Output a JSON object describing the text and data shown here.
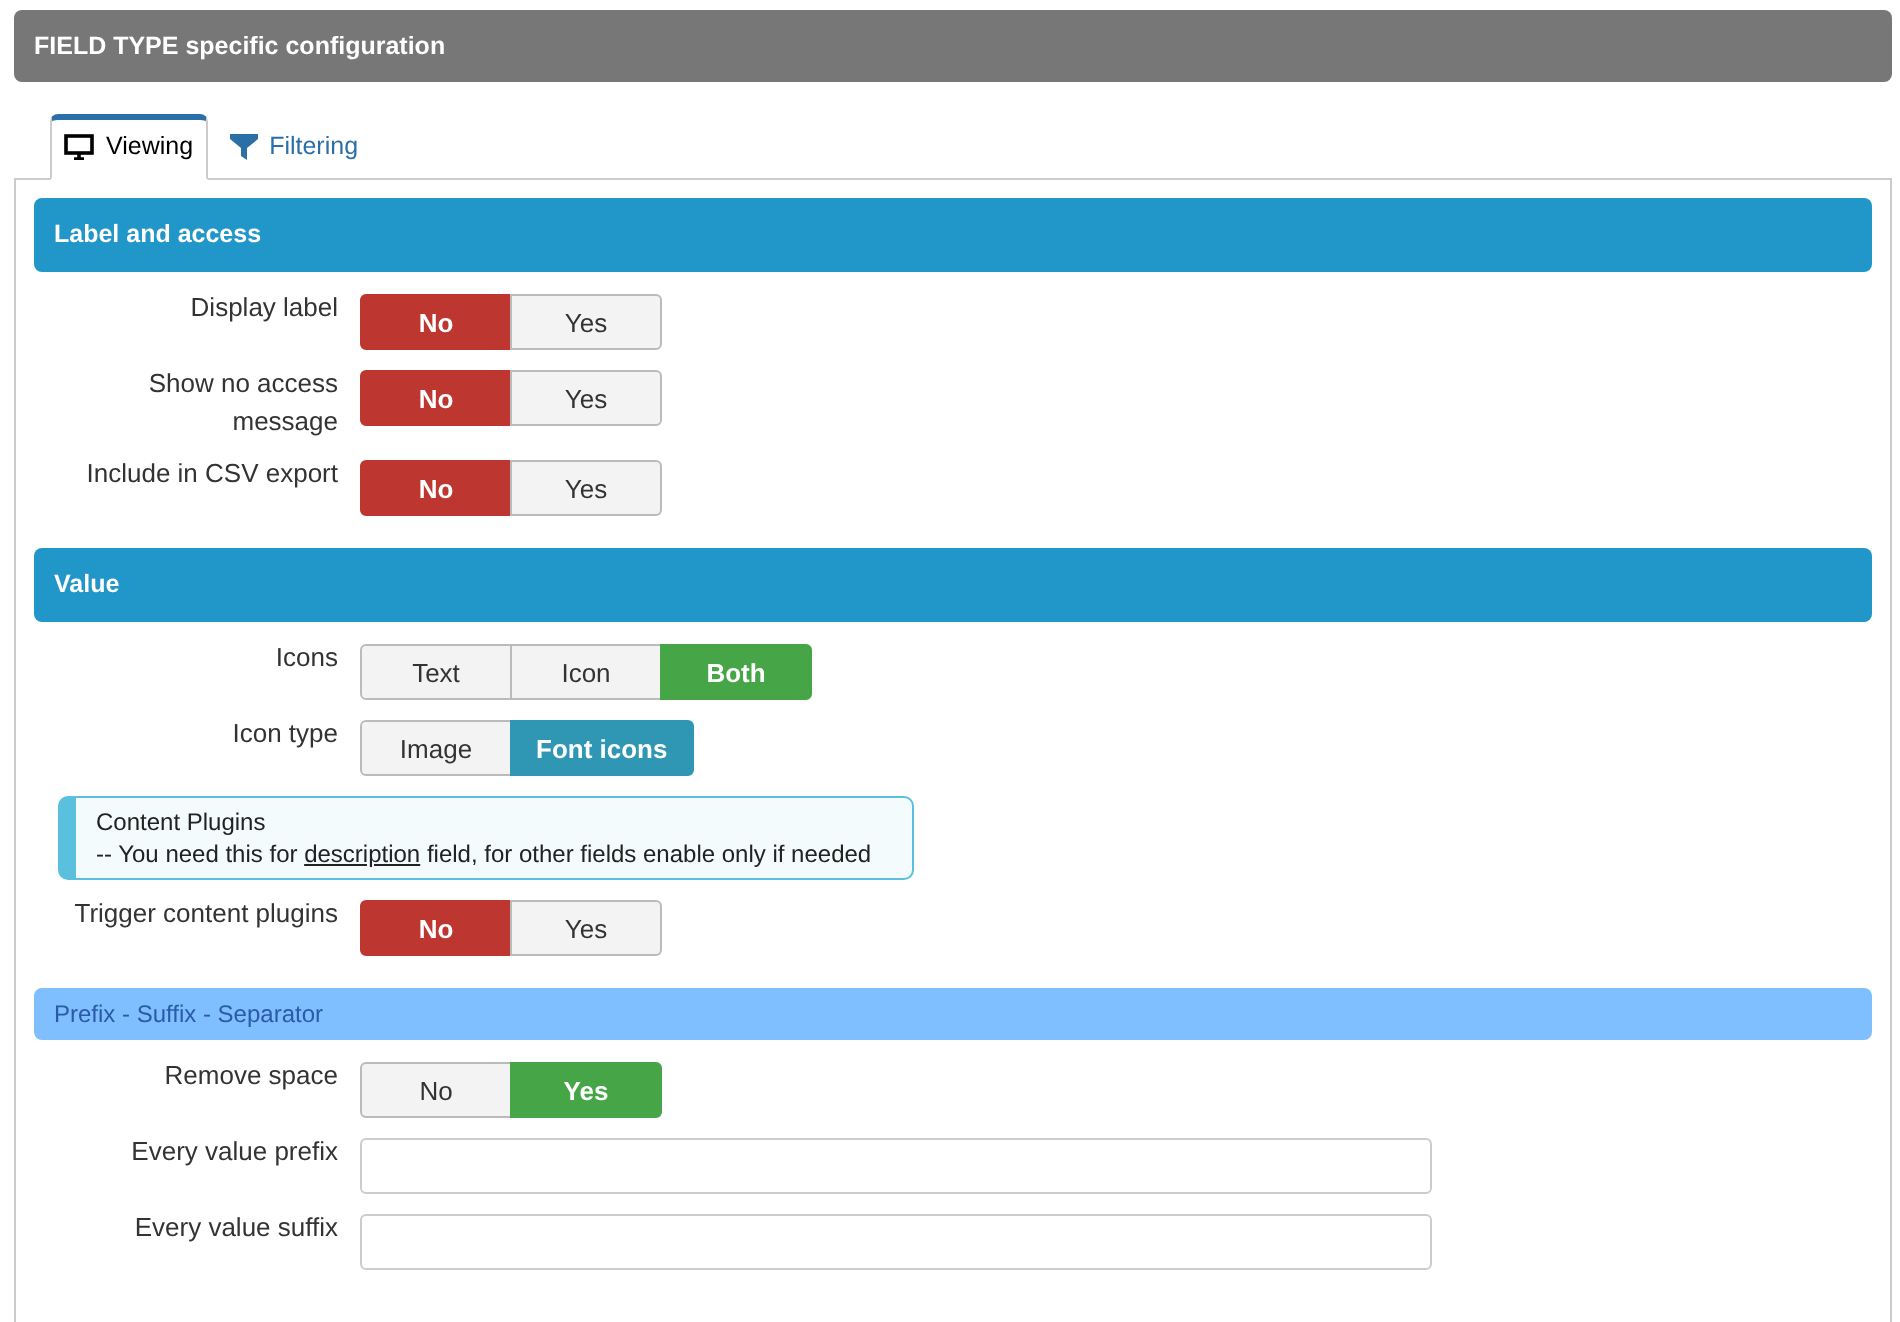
{
  "header": {
    "title": "FIELD TYPE specific configuration"
  },
  "tabs": [
    {
      "label": "Viewing",
      "selected": true
    },
    {
      "label": "Filtering",
      "selected": false
    }
  ],
  "sections": [
    {
      "kind": "primary",
      "title": "Label and access",
      "rows": [
        {
          "kind": "toggle",
          "label": "Display label",
          "options": [
            {
              "label": "No",
              "selected": true,
              "color": "#bd362f"
            },
            {
              "label": "Yes",
              "selected": false
            }
          ]
        },
        {
          "kind": "toggle",
          "label": "Show no access message",
          "options": [
            {
              "label": "No",
              "selected": true,
              "color": "#bd362f"
            },
            {
              "label": "Yes",
              "selected": false
            }
          ]
        },
        {
          "kind": "toggle",
          "label": "Include in CSV export",
          "options": [
            {
              "label": "No",
              "selected": true,
              "color": "#bd362f"
            },
            {
              "label": "Yes",
              "selected": false
            }
          ]
        }
      ]
    },
    {
      "kind": "primary",
      "title": "Value",
      "rows": [
        {
          "kind": "toggle",
          "label": "Icons",
          "options": [
            {
              "label": "Text",
              "selected": false
            },
            {
              "label": "Icon",
              "selected": false
            },
            {
              "label": "Both",
              "selected": true,
              "color": "#46a546"
            }
          ]
        },
        {
          "kind": "toggle",
          "label": "Icon type",
          "options": [
            {
              "label": "Image",
              "selected": false
            },
            {
              "label": "Font icons",
              "selected": true,
              "color": "#2f96b4"
            }
          ]
        },
        {
          "kind": "note",
          "title": "Content Plugins",
          "text": "-- You need this for ",
          "link": "description",
          "text_after": " field, for other fields enable only if needed"
        },
        {
          "kind": "toggle",
          "label": "Trigger content plugins",
          "options": [
            {
              "label": "No",
              "selected": true,
              "color": "#bd362f"
            },
            {
              "label": "Yes",
              "selected": false
            }
          ]
        }
      ]
    },
    {
      "kind": "sub",
      "title": "Prefix - Suffix - Separator",
      "rows": [
        {
          "kind": "toggle",
          "label": "Remove space",
          "options": [
            {
              "label": "No",
              "selected": false
            },
            {
              "label": "Yes",
              "selected": true,
              "color": "#46a546"
            }
          ]
        },
        {
          "kind": "input",
          "label": "Every value prefix"
        },
        {
          "kind": "input",
          "label": "Every value suffix"
        }
      ]
    }
  ]
}
